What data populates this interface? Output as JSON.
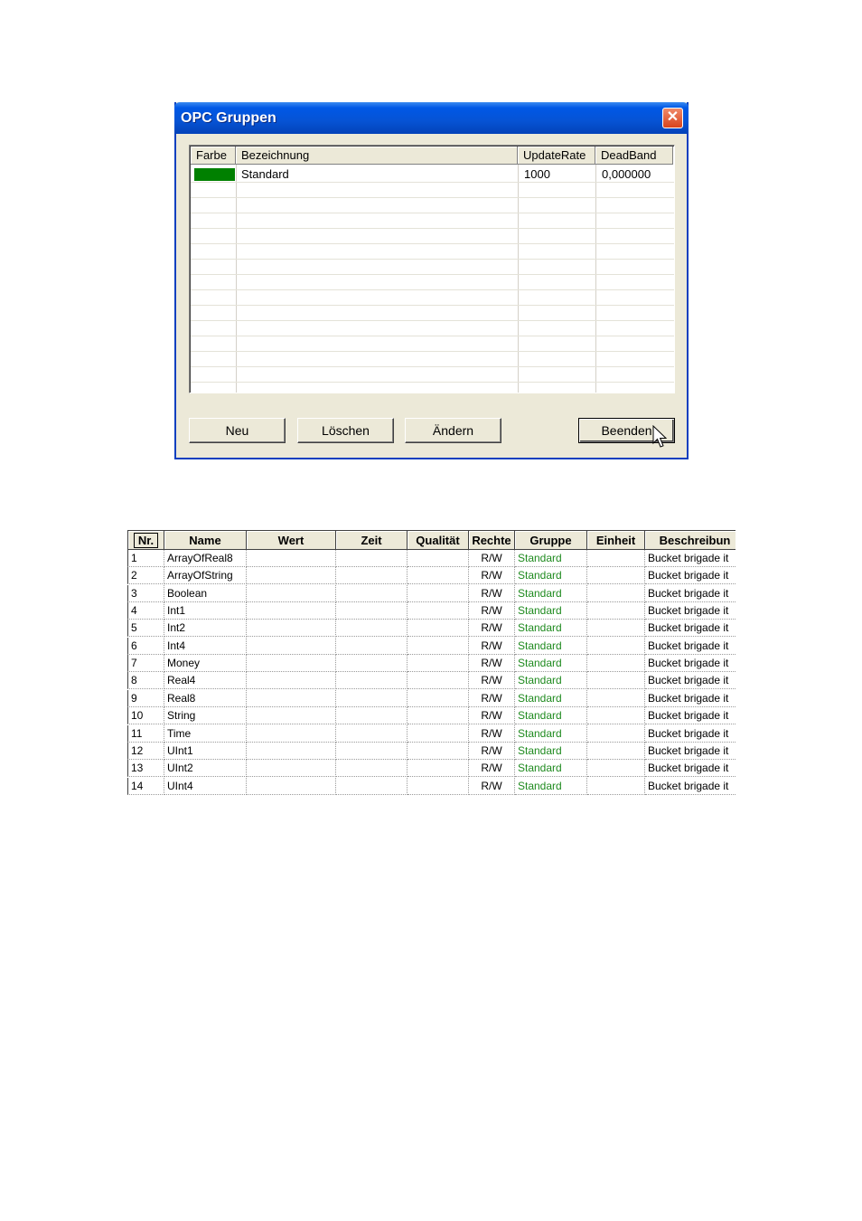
{
  "dialog": {
    "title": "OPC Gruppen",
    "close_glyph": "✕",
    "columns": [
      "Farbe",
      "Bezeichnung",
      "UpdateRate",
      "DeadBand"
    ],
    "rows": [
      {
        "color": "#008000",
        "bezeichnung": "Standard",
        "update_rate": "1000",
        "dead_band": "0,000000"
      }
    ],
    "buttons": {
      "neu": "Neu",
      "loeschen": "Löschen",
      "aendern": "Ändern",
      "beenden": "Beenden"
    }
  },
  "table": {
    "columns": [
      "Nr.",
      "Name",
      "Wert",
      "Zeit",
      "Qualität",
      "Rechte",
      "Gruppe",
      "Einheit",
      "Beschreibun"
    ],
    "rows": [
      {
        "nr": "1",
        "name": "ArrayOfReal8",
        "rechte": "R/W",
        "gruppe": "Standard",
        "beschreibung": "Bucket brigade it"
      },
      {
        "nr": "2",
        "name": "ArrayOfString",
        "rechte": "R/W",
        "gruppe": "Standard",
        "beschreibung": "Bucket brigade it"
      },
      {
        "nr": "3",
        "name": "Boolean",
        "rechte": "R/W",
        "gruppe": "Standard",
        "beschreibung": "Bucket brigade it"
      },
      {
        "nr": "4",
        "name": "Int1",
        "rechte": "R/W",
        "gruppe": "Standard",
        "beschreibung": "Bucket brigade it"
      },
      {
        "nr": "5",
        "name": "Int2",
        "rechte": "R/W",
        "gruppe": "Standard",
        "beschreibung": "Bucket brigade it"
      },
      {
        "nr": "6",
        "name": "Int4",
        "rechte": "R/W",
        "gruppe": "Standard",
        "beschreibung": "Bucket brigade it"
      },
      {
        "nr": "7",
        "name": "Money",
        "rechte": "R/W",
        "gruppe": "Standard",
        "beschreibung": "Bucket brigade it"
      },
      {
        "nr": "8",
        "name": "Real4",
        "rechte": "R/W",
        "gruppe": "Standard",
        "beschreibung": "Bucket brigade it"
      },
      {
        "nr": "9",
        "name": "Real8",
        "rechte": "R/W",
        "gruppe": "Standard",
        "beschreibung": "Bucket brigade it"
      },
      {
        "nr": "10",
        "name": "String",
        "rechte": "R/W",
        "gruppe": "Standard",
        "beschreibung": "Bucket brigade it"
      },
      {
        "nr": "11",
        "name": "Time",
        "rechte": "R/W",
        "gruppe": "Standard",
        "beschreibung": "Bucket brigade it"
      },
      {
        "nr": "12",
        "name": "UInt1",
        "rechte": "R/W",
        "gruppe": "Standard",
        "beschreibung": "Bucket brigade it"
      },
      {
        "nr": "13",
        "name": "UInt2",
        "rechte": "R/W",
        "gruppe": "Standard",
        "beschreibung": "Bucket brigade it"
      },
      {
        "nr": "14",
        "name": "UInt4",
        "rechte": "R/W",
        "gruppe": "Standard",
        "beschreibung": "Bucket brigade it"
      }
    ]
  }
}
